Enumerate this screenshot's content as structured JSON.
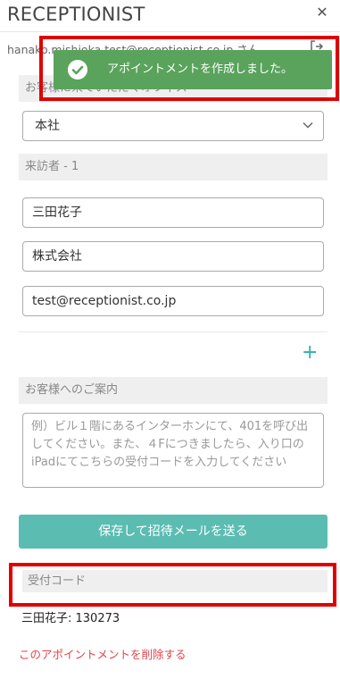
{
  "app": {
    "title": "RECEPTIONIST"
  },
  "header": {
    "user_email": "hanako.mishioka.test@receptionist.co.jp さん"
  },
  "toast": {
    "message": "アポイントメントを作成しました。"
  },
  "office": {
    "section_label": "お客様に来ていただくオフィス",
    "selected": "本社"
  },
  "visitor": {
    "section_label": "来訪者 - 1",
    "name": "三田花子",
    "company": "株式会社",
    "email": "test@receptionist.co.jp"
  },
  "guidance": {
    "section_label": "お客様へのご案内",
    "placeholder": "例）ビル１階にあるインターホンにて、401を呼び出してください。また、４Fにつきましたら、入り口のiPadにてこちらの受付コードを入力してください"
  },
  "actions": {
    "submit_label": "保存して招待メールを送る",
    "delete_label": "このアポイントメントを削除する"
  },
  "reception_code": {
    "label": "受付コード",
    "value": "三田花子: 130273"
  },
  "colors": {
    "accent": "#5bbcb2",
    "toast_bg": "#5aa35c",
    "danger": "#e0464b",
    "highlight": "#e00000"
  }
}
